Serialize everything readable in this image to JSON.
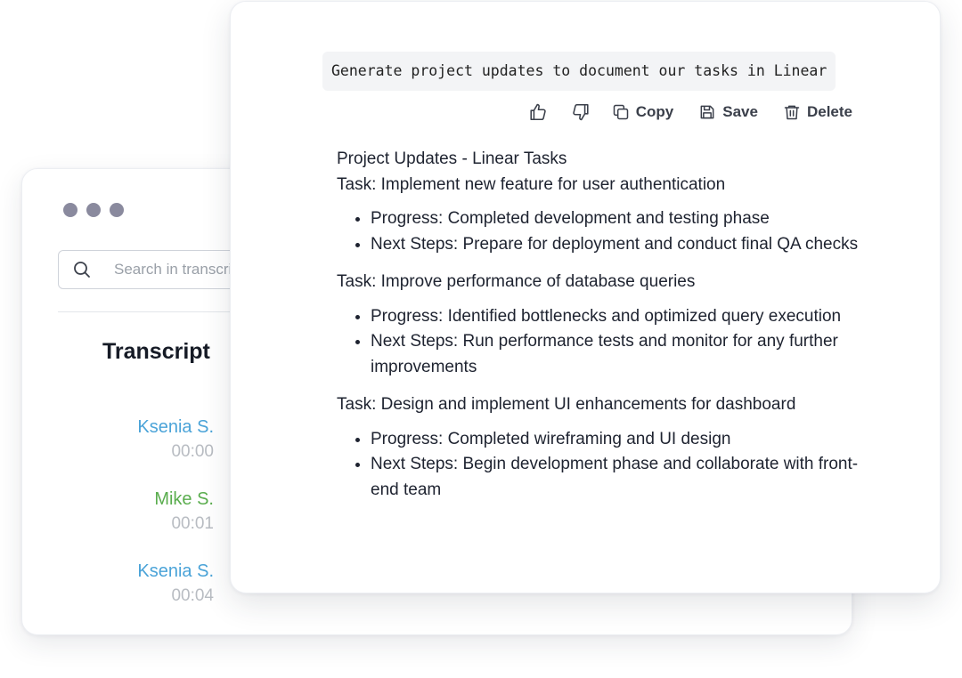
{
  "transcript_window": {
    "search": {
      "placeholder": "Search in transcript"
    },
    "title": "Transcript",
    "entries": [
      {
        "speaker": "Ksenia S.",
        "time": "00:00",
        "color": "#4aa3d8"
      },
      {
        "speaker": "Mike S.",
        "time": "00:01",
        "color": "#5aad4e"
      },
      {
        "speaker": "Ksenia S.",
        "time": "00:04",
        "color": "#4aa3d8"
      }
    ]
  },
  "response_card": {
    "prompt": "Generate project updates to document our tasks in Linear",
    "actions": {
      "thumbs_up_icon": "thumbs-up-icon",
      "thumbs_down_icon": "thumbs-down-icon",
      "copy_label": "Copy",
      "save_label": "Save",
      "delete_label": "Delete"
    },
    "heading": "Project Updates - Linear Tasks",
    "tasks": [
      {
        "title": "Task: Implement new feature for user authentication",
        "progress": "Progress: Completed development and testing phase",
        "next_steps": "Next Steps: Prepare for deployment and conduct final QA checks"
      },
      {
        "title": "Task: Improve performance of database queries",
        "progress": "Progress: Identified bottlenecks and optimized query execution",
        "next_steps": "Next Steps: Run performance tests and monitor for any further improvements"
      },
      {
        "title": "Task: Design and implement UI enhancements for dashboard",
        "progress": "Progress: Completed wireframing and UI design",
        "next_steps": "Next Steps: Begin development phase and collaborate with front-end team"
      }
    ]
  },
  "colors": {
    "window_dots": "#8a8a9e",
    "speaker_blue": "#4aa3d8",
    "speaker_green": "#5aad4e",
    "timestamp": "#b8bcc2"
  }
}
